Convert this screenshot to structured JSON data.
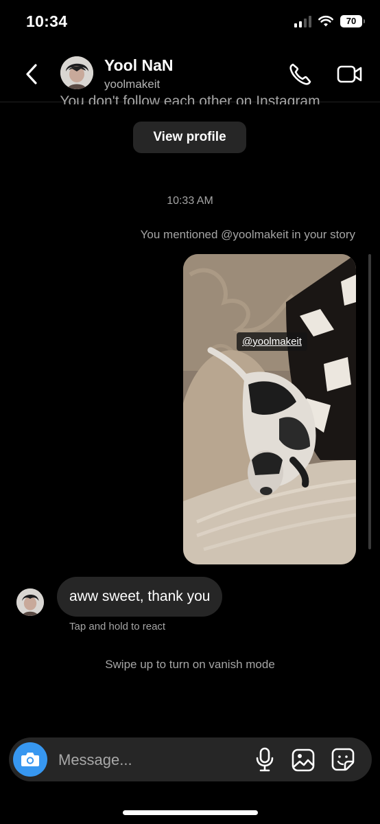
{
  "status_bar": {
    "time": "10:34",
    "battery": "70"
  },
  "header": {
    "name": "Yool NaN",
    "handle": "yoolmakeit",
    "icons": {
      "back": "chevron-left-icon",
      "call": "phone-icon",
      "video": "video-camera-icon"
    }
  },
  "thread": {
    "follow_note": "You don't follow each other on Instagram",
    "view_profile_label": "View profile",
    "timestamp": "10:33 AM",
    "mention_note": "You mentioned @yoolmakeit in your story",
    "story_mention_tag": "@yoolmakeit",
    "reply_text": "aww sweet, thank you",
    "react_hint": "Tap and hold to react",
    "vanish_hint": "Swipe up to turn on vanish mode"
  },
  "composer": {
    "placeholder": "Message...",
    "value": "",
    "icons": {
      "camera": "camera-icon",
      "mic": "microphone-icon",
      "gallery": "image-icon",
      "sticker": "sticker-icon"
    },
    "camera_color": "#3797f0"
  }
}
